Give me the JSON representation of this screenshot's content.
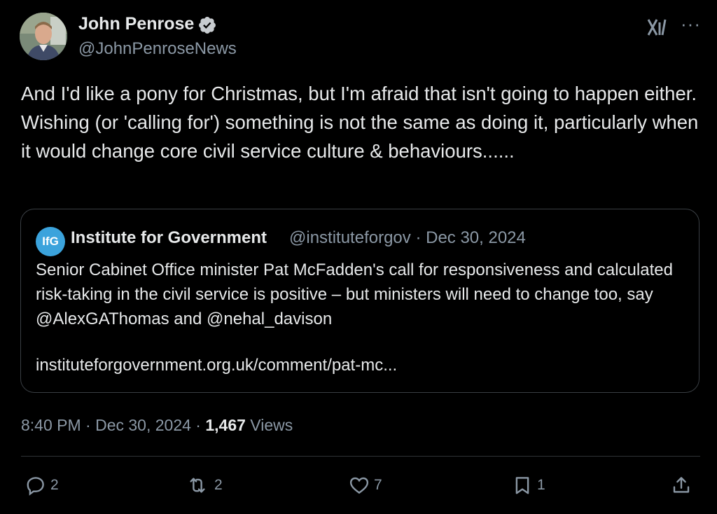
{
  "author": {
    "name": "John Penrose",
    "handle": "@JohnPenroseNews",
    "verified_color": "#1d9bf0"
  },
  "icons": {
    "verified": "verified-badge-icon",
    "logo": "x-logo-icon",
    "more": "more-options-icon"
  },
  "tweet": {
    "text": "And I'd like a pony for Christmas, but I'm afraid that isn't going to happen either. Wishing (or 'calling for') something is not the same as doing it, particularly when it would change core civil service culture & behaviours......"
  },
  "quote": {
    "logo_text": "IfG",
    "name": "Institute for Government",
    "meta": "@instituteforgov · Dec 30, 2024",
    "text": "Senior Cabinet Office minister Pat McFadden's call for responsiveness and calculated risk-taking in the civil service is positive – but ministers will need to change too, say @AlexGAThomas and @nehal_davison",
    "link": "instituteforgovernment.org.uk/comment/pat-mc..."
  },
  "meta": {
    "time_date": "8:40 PM · Dec 30, 2024 · ",
    "views_count": "1,467",
    "views_label": " Views"
  },
  "actions": {
    "replies": "2",
    "reposts": "2",
    "likes": "7",
    "bookmarks": "1"
  },
  "colors": {
    "background": "#000000",
    "text": "#e7e9ea",
    "muted": "#8b98a5",
    "ifg_blue": "#3ba3dc"
  }
}
